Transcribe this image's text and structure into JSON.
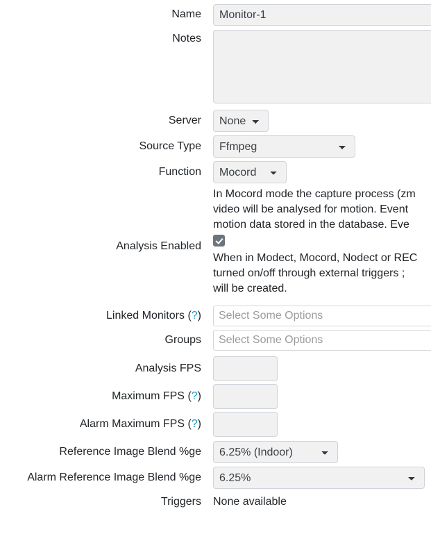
{
  "form": {
    "rows": {
      "name": {
        "label": "Name",
        "value": "Monitor-1"
      },
      "notes": {
        "label": "Notes",
        "value": ""
      },
      "server": {
        "label": "Server",
        "value": "None"
      },
      "source_type": {
        "label": "Source Type",
        "value": "Ffmpeg"
      },
      "function": {
        "label": "Function",
        "value": "Mocord"
      },
      "analysis_enabled": {
        "label": "Analysis Enabled",
        "checked": true,
        "description_above": {
          "line1": "In Mocord mode the capture process (zm",
          "line2": "video will be analysed for motion. Event",
          "line3": "motion data stored in the database. Eve"
        },
        "description_below": {
          "line1": "When in Modect, Mocord, Nodect or REC",
          "line2": "turned on/off through external triggers ;",
          "line3": "will be created."
        }
      },
      "linked_monitors": {
        "label": "Linked Monitors",
        "help": "(?)",
        "help_symbol": "?",
        "placeholder": "Select Some Options",
        "value": ""
      },
      "groups": {
        "label": "Groups",
        "placeholder": "Select Some Options",
        "value": ""
      },
      "analysis_fps": {
        "label": "Analysis FPS",
        "value": ""
      },
      "maximum_fps": {
        "label": "Maximum FPS",
        "help_symbol": "?",
        "value": ""
      },
      "alarm_maximum_fps": {
        "label": "Alarm Maximum FPS",
        "help_symbol": "?",
        "value": ""
      },
      "reference_image_blend": {
        "label": "Reference Image Blend %ge",
        "value": "6.25% (Indoor)"
      },
      "alarm_reference_image_blend": {
        "label": "Alarm Reference Image Blend %ge",
        "value": "6.25%"
      },
      "triggers": {
        "label": "Triggers",
        "value": "None available"
      }
    }
  },
  "colors": {
    "help_link": "#2196c4",
    "checkbox_fill": "#6c757d",
    "control_bg": "#f1f1f1",
    "control_border": "#ced4da",
    "text": "#212529",
    "placeholder": "#9b9b9b"
  }
}
